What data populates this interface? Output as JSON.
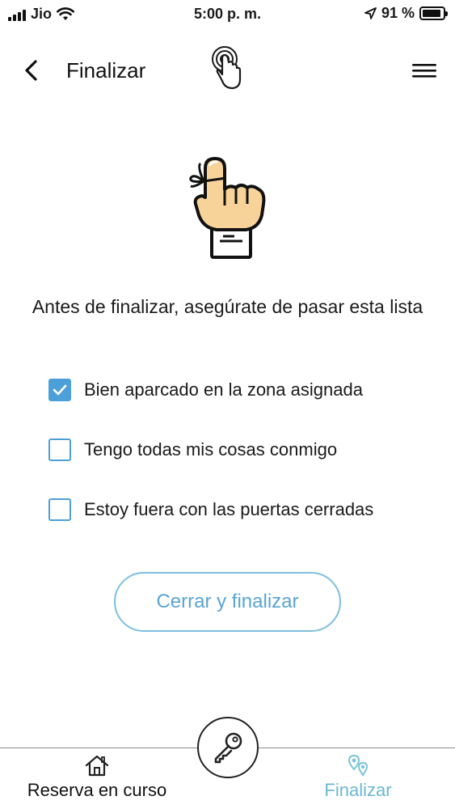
{
  "status_bar": {
    "carrier": "Jio",
    "time": "5:00 p. m.",
    "battery": "91 %",
    "battery_level": 0.91
  },
  "header": {
    "title": "Finalizar",
    "back_icon": "chevron-left-icon",
    "logo_icon": "touch-hand-icon",
    "menu_icon": "hamburger-menu-icon"
  },
  "illustration": {
    "icon": "reminder-finger-icon"
  },
  "instructions": "Antes de finalizar, asegúrate de pasar esta lista",
  "checklist": [
    {
      "label": "Bien aparcado en la zona asignada",
      "checked": true
    },
    {
      "label": "Tengo todas mis cosas conmigo",
      "checked": false
    },
    {
      "label": "Estoy fuera con las puertas cerradas",
      "checked": false
    }
  ],
  "primary_button": "Cerrar y finalizar",
  "tab_bar": {
    "home": {
      "label": "Reserva en curso",
      "icon": "home-icon"
    },
    "center": {
      "icon": "key-icon"
    },
    "finish": {
      "label": "Finalizar",
      "icon": "map-pins-icon",
      "active": true
    }
  },
  "colors": {
    "accent": "#4d9fd8",
    "button_border": "#7dc0de",
    "button_text": "#5aa4d4",
    "active_tab": "#6bb8cf"
  }
}
